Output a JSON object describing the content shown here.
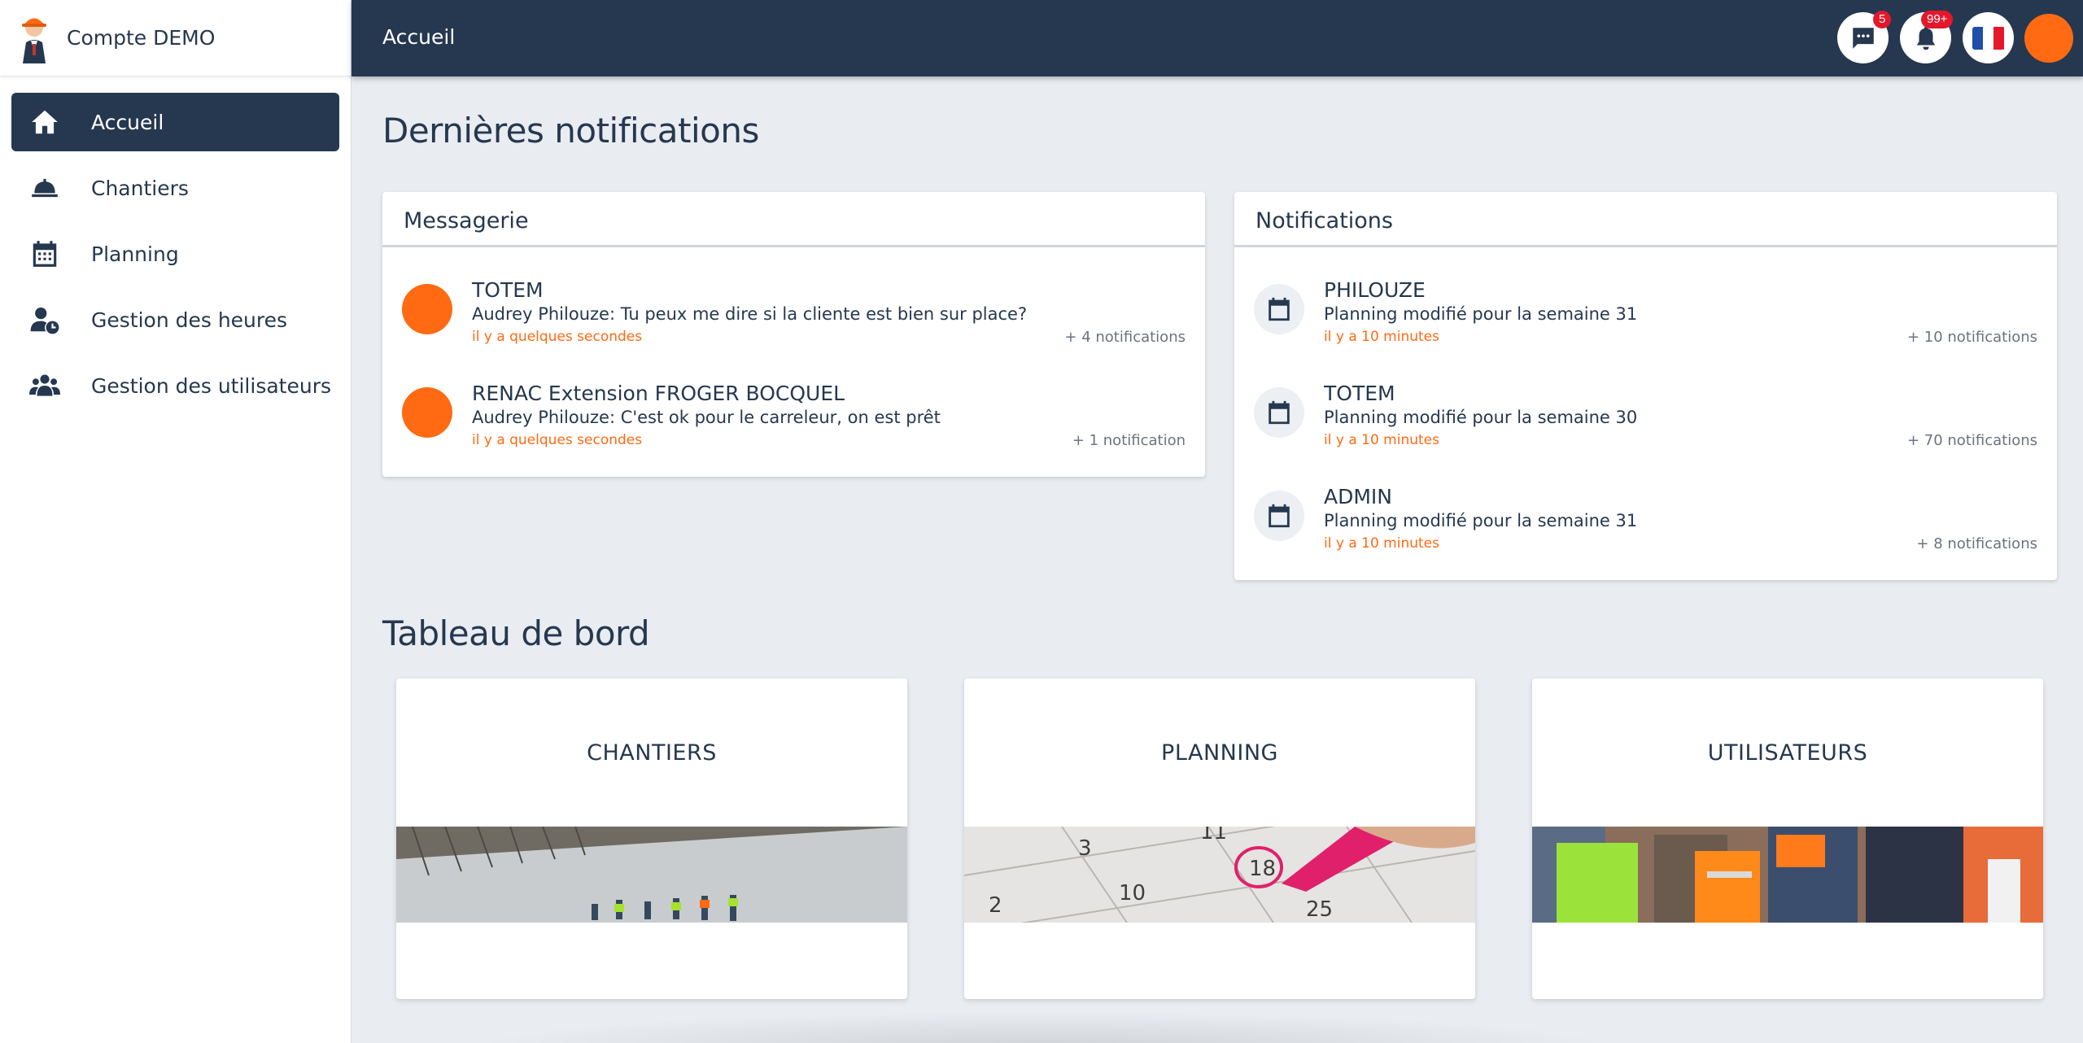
{
  "brand": {
    "name": "Compte DEMO"
  },
  "sidebar": {
    "items": [
      {
        "label": "Accueil",
        "icon": "home-icon",
        "active": true
      },
      {
        "label": "Chantiers",
        "icon": "hard-hat-icon"
      },
      {
        "label": "Planning",
        "icon": "calendar-icon"
      },
      {
        "label": "Gestion des heures",
        "icon": "user-clock-icon"
      },
      {
        "label": "Gestion des utilisateurs",
        "icon": "users-icon"
      }
    ]
  },
  "topbar": {
    "title": "Accueil",
    "messages_badge": "5",
    "notifications_badge": "99+",
    "language": "fr"
  },
  "main": {
    "notifications_title": "Dernières notifications",
    "dashboard_title": "Tableau de bord"
  },
  "messagerie": {
    "title": "Messagerie",
    "items": [
      {
        "title": "TOTEM",
        "message": "Audrey Philouze: Tu peux me dire si la cliente est bien sur place?",
        "time": "il y a quelques secondes",
        "count": "+ 4 notifications"
      },
      {
        "title": "RENAC Extension FROGER BOCQUEL",
        "message": "Audrey Philouze: C'est ok pour le carreleur, on est prêt",
        "time": "il y a quelques secondes",
        "count": "+ 1 notification"
      }
    ]
  },
  "notifications": {
    "title": "Notifications",
    "items": [
      {
        "title": "PHILOUZE",
        "message": "Planning modifié pour la semaine 31",
        "time": "il y a 10 minutes",
        "count": "+ 10 notifications"
      },
      {
        "title": "TOTEM",
        "message": "Planning modifié pour la semaine 30",
        "time": "il y a 10 minutes",
        "count": "+ 70 notifications"
      },
      {
        "title": "ADMIN",
        "message": "Planning modifié pour la semaine 31",
        "time": "il y a 10 minutes",
        "count": "+ 8 notifications"
      }
    ]
  },
  "dashboard": {
    "cards": [
      {
        "label": "CHANTIERS"
      },
      {
        "label": "PLANNING"
      },
      {
        "label": "UTILISATEURS"
      }
    ]
  },
  "colors": {
    "navy": "#26384f",
    "accent": "#ff6a13",
    "badge": "#e4172b",
    "background": "#e9ecf1"
  }
}
